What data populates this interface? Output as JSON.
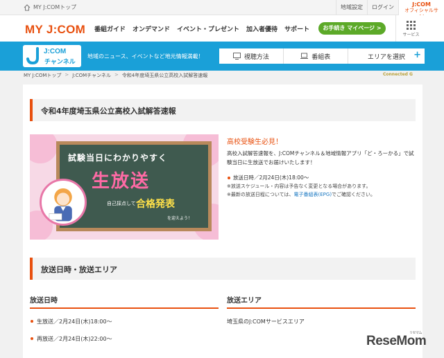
{
  "topbar": {
    "home_label": "MY J:COMトップ",
    "links": [
      "地域設定",
      "ログイン",
      "J:COM",
      "オフィシャルサイト"
    ]
  },
  "header": {
    "logo": "MY J:COM",
    "nav": [
      "番組ガイド",
      "オンデマンド",
      "イベント・プレゼント",
      "加入者優待",
      "サポート"
    ],
    "mypage_button": "お手続き マイページ >",
    "service_label": "サービス"
  },
  "channel": {
    "logo_line1": "J:COM",
    "logo_line2": "チャンネル",
    "description": "地域のニュース、イベントなど地元情報満載！",
    "nav": [
      "視聴方法",
      "番組表",
      "エリアを選択"
    ],
    "plus": "+"
  },
  "breadcrumb": [
    "MY J:COMトップ",
    "J:COMチャンネル",
    "令和4年度埼玉県公立高校入試解答速報"
  ],
  "breadcrumb_sep": ">",
  "g_mark": "Connected G",
  "article": {
    "title": "令和4年度埼玉県公立高校入試解答速報",
    "banner": {
      "line1": "試験当日にわかりやすく",
      "line2": "生放送",
      "line3": "自己採点して",
      "line4": "合格発表",
      "line5": "を迎えよう！"
    },
    "intro_title": "高校受験生必見！",
    "intro_lead": "高校入試解答速報を、J:COMチャンネル＆地域情報アプリ「ど・ろーかる」で試験当日に生放送でお届けいたします！",
    "broadcast_time": "放送日時／2月24日(木)18:00〜",
    "note1": "※放送スケジュール・内容は予告なく変更となる場合があります。",
    "note2_pre": "※最新の放送日程については、",
    "note2_link": "電子番組表(EPG)",
    "note2_post": "でご確認ください。"
  },
  "section2": {
    "title": "放送日時・放送エリア",
    "left_heading": "放送日時",
    "left_items": [
      "生放送／2月24日(木)18:00〜",
      "再放送／2月24日(木)22:00〜"
    ],
    "right_heading": "放送エリア",
    "right_items": [
      "埼玉県のJ:COMサービスエリア"
    ]
  },
  "watermark": {
    "text": "ReseMom",
    "sub": "リセマム"
  },
  "colors": {
    "brand_orange": "#e8500f",
    "channel_blue": "#1aa0d8",
    "mypage_green": "#5ca928"
  }
}
